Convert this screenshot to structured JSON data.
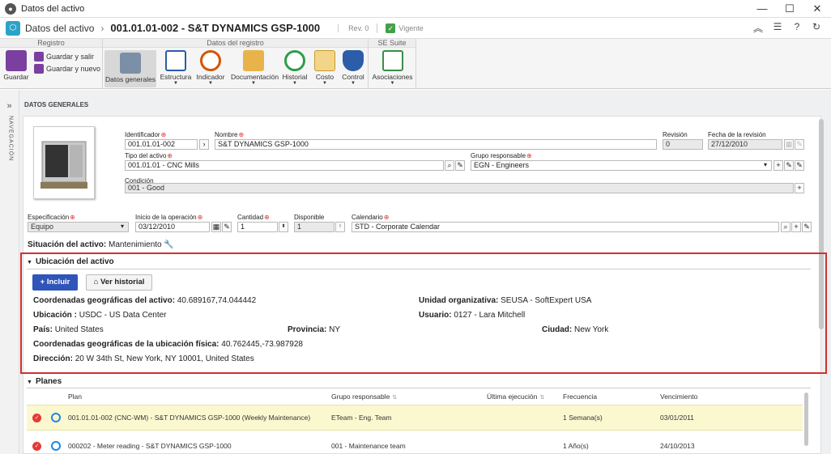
{
  "window": {
    "title": "Datos del activo"
  },
  "header": {
    "section": "Datos del activo",
    "doc_title": "001.01.01-002 - S&T DYNAMICS GSP-1000",
    "rev": "Rev. 0",
    "status": "Vigente"
  },
  "ribbon": {
    "groups": {
      "registro": "Registro",
      "datos": "Datos del registro",
      "suite": "SE Suite"
    },
    "guardar": "Guardar",
    "guardar_salir": "Guardar y salir",
    "guardar_nuevo": "Guardar y nuevo",
    "datos_generales": "Datos generales",
    "estructura": "Estructura",
    "indicador": "Indicador",
    "documentacion": "Documentación",
    "historial": "Historial",
    "costo": "Costo",
    "control": "Control",
    "asociaciones": "Asociaciones"
  },
  "nav": {
    "label": "NAVEGACIÓN"
  },
  "form": {
    "panel_title": "DATOS GENERALES",
    "identificador_label": "Identificador",
    "identificador": "001.01.01-002",
    "nombre_label": "Nombre",
    "nombre": "S&T DYNAMICS GSP-1000",
    "revision_label": "Revisión",
    "revision": "0",
    "fecha_rev_label": "Fecha de la revisión",
    "fecha_rev": "27/12/2010",
    "tipo_label": "Tipo del activo",
    "tipo": "001.01.01 - CNC Mills",
    "grupo_label": "Grupo responsable",
    "grupo": "EGN - Engineers",
    "condicion_label": "Condición",
    "condicion": "001 - Good",
    "especificacion_label": "Especificación",
    "especificacion": "Equipo",
    "inicio_label": "Inicio de la operación",
    "inicio": "03/12/2010",
    "cantidad_label": "Cantidad",
    "cantidad": "1",
    "disponible_label": "Disponible",
    "disponible": "1",
    "calendario_label": "Calendario",
    "calendario": "STD - Corporate Calendar",
    "situacion_label": "Situación del activo:",
    "situacion": "Mantenimiento"
  },
  "ubicacion": {
    "title": "Ubicación del activo",
    "incluir": "Incluir",
    "ver_historial": "Ver historial",
    "coord_label": "Coordenadas geográficas del activo:",
    "coord": "40.689167,74.044442",
    "unidad_label": "Unidad organizativa:",
    "unidad": "SEUSA - SoftExpert USA",
    "ubicacion_label": "Ubicación :",
    "ubicacion": "USDC - US Data Center",
    "usuario_label": "Usuario:",
    "usuario": "0127 - Lara Mitchell",
    "pais_label": "País:",
    "pais": "United States",
    "provincia_label": "Provincia:",
    "provincia": "NY",
    "ciudad_label": "Ciudad:",
    "ciudad": "New York",
    "coord_fis_label": "Coordenadas geográficas de la ubicación física:",
    "coord_fis": "40.762445,-73.987928",
    "direccion_label": "Dirección:",
    "direccion": "20 W 34th St, New York, NY 10001, United States"
  },
  "planes": {
    "title": "Planes",
    "headers": {
      "plan": "Plan",
      "grupo": "Grupo responsable",
      "ultima": "Última ejecución",
      "frecuencia": "Frecuencia",
      "vencimiento": "Vencimiento"
    },
    "rows": [
      {
        "plan": "001.01.01-002 (CNC-WM) - S&T DYNAMICS GSP-1000 (Weekly Maintenance)",
        "grupo": "ETeam - Eng. Team",
        "frecuencia": "1 Semana(s)",
        "vencimiento": "03/01/2011"
      },
      {
        "plan": "000202 - Meter reading - S&T DYNAMICS GSP-1000",
        "grupo": "001 - Maintenance team",
        "frecuencia": "1 Año(s)",
        "vencimiento": "24/10/2013"
      }
    ]
  }
}
